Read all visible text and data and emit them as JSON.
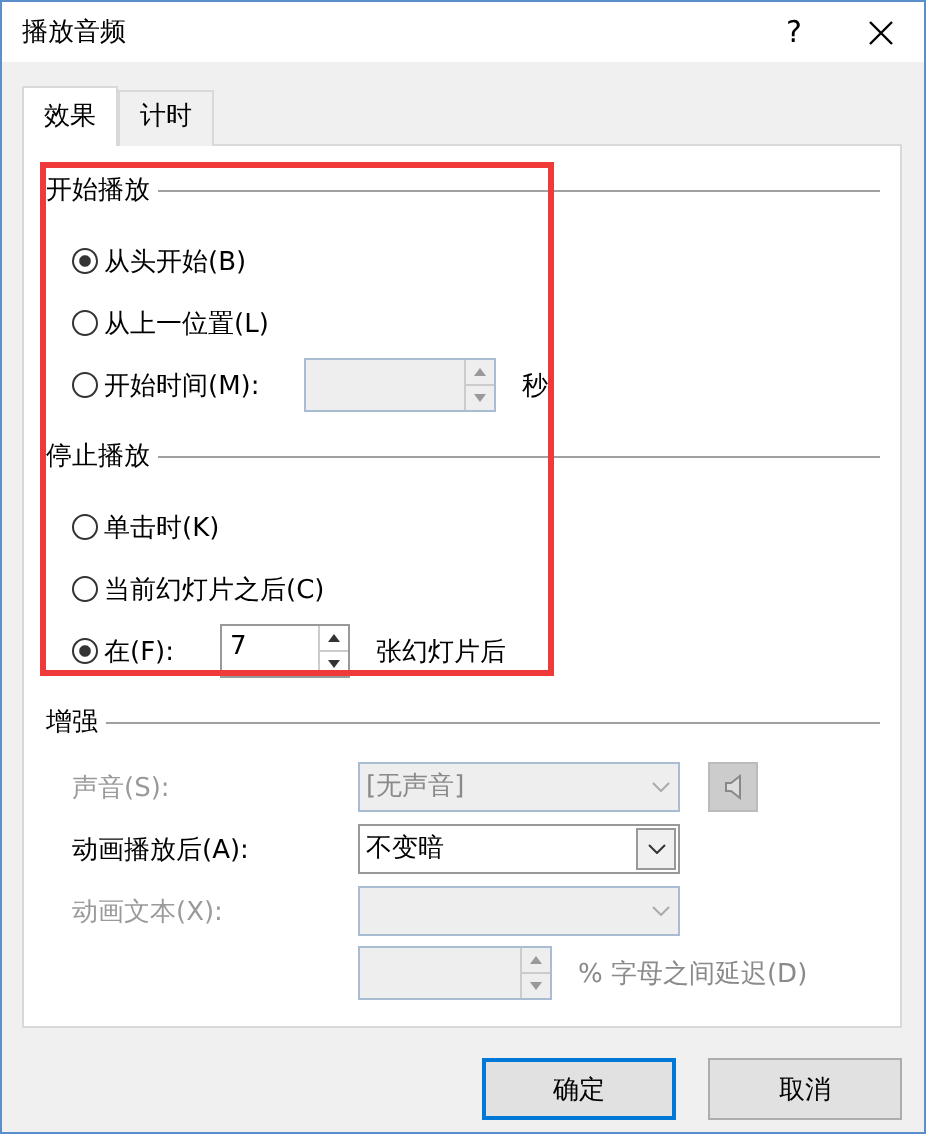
{
  "window": {
    "title": "播放音频",
    "help": "?"
  },
  "tabs": [
    {
      "label": "效果",
      "selected": true
    },
    {
      "label": "计时",
      "selected": false
    }
  ],
  "groups": [
    {
      "title": "开始播放",
      "options": [
        {
          "kind": "plain",
          "label": "从头开始(B)",
          "selected": true
        },
        {
          "kind": "plain",
          "label": "从上一位置(L)",
          "selected": false
        },
        {
          "kind": "spin",
          "label": "开始时间(M):",
          "selected": false,
          "disabled": true,
          "suffix": "秒"
        }
      ]
    },
    {
      "title": "停止播放",
      "options": [
        {
          "kind": "plain",
          "label": "单击时(K)",
          "selected": false
        },
        {
          "kind": "plain",
          "label": "当前幻灯片之后(C)",
          "selected": false
        },
        {
          "kind": "spin",
          "label": "在(F):",
          "selected": true,
          "disabled": false,
          "value": "7",
          "suffix": "张幻灯片后"
        }
      ]
    }
  ],
  "enhance": {
    "title": "增强",
    "rows": [
      {
        "kind": "combo",
        "label": "声音(S):",
        "value": "[无声音]",
        "disabled": true,
        "speaker": true
      },
      {
        "kind": "combo",
        "label": "动画播放后(A):",
        "value": "不变暗",
        "disabled": false
      },
      {
        "kind": "combo",
        "label": "动画文本(X):",
        "disabled": true
      },
      {
        "kind": "spin",
        "disabled": true,
        "suffix": "% 字母之间延迟(D)"
      }
    ]
  },
  "buttons": [
    {
      "label": "确定",
      "default": true
    },
    {
      "label": "取消",
      "default": false
    }
  ]
}
